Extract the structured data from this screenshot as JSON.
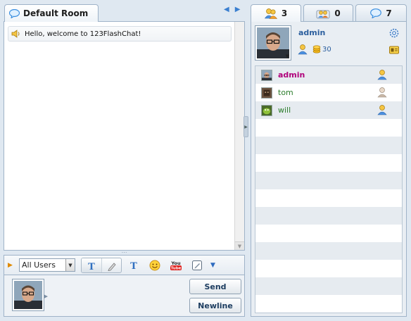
{
  "room": {
    "tab_label": "Default Room",
    "nav_prev": "◀",
    "nav_next": "▶"
  },
  "messages": [
    {
      "text": "Hello, welcome to 123FlashChat!",
      "icon": "speaker-icon"
    }
  ],
  "toolbar": {
    "user_filter_value": "All Users",
    "expand_glyph": "▶",
    "more_glyph": "▼",
    "icons": [
      "text-style-icon",
      "pen-icon",
      "font-icon",
      "emoticon-icon",
      "youtube-icon",
      "whiteboard-icon"
    ]
  },
  "input": {
    "send_label": "Send",
    "newline_label": "Newline"
  },
  "tabs": {
    "users_count": "3",
    "rooms_count": "0",
    "chats_count": "7"
  },
  "profile": {
    "name": "admin",
    "coins": "30"
  },
  "users": [
    {
      "name": "admin",
      "role": "admin",
      "avatar": "admin-avatar",
      "status": "available"
    },
    {
      "name": "tom",
      "role": "normal",
      "avatar": "tom-avatar",
      "status": "away"
    },
    {
      "name": "will",
      "role": "normal",
      "avatar": "will-avatar",
      "status": "available"
    }
  ],
  "colors": {
    "accent": "#2c5f9e",
    "admin_name": "#b0007a",
    "user_name": "#2b7d2b",
    "panel_bg": "#dfe8f1"
  }
}
